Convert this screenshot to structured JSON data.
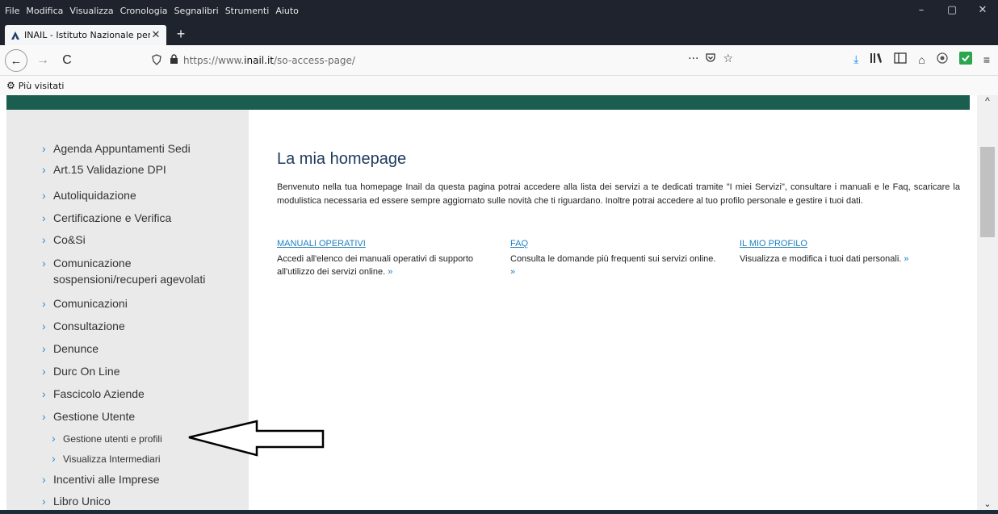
{
  "menubar": {
    "items": [
      "File",
      "Modifica",
      "Visualizza",
      "Cronologia",
      "Segnalibri",
      "Strumenti",
      "Aiuto"
    ]
  },
  "window_controls": {
    "minimize": "–",
    "maximize": "▢",
    "close": "✕"
  },
  "tab": {
    "title": "INAIL - Istituto Nazionale per l'A",
    "close": "✕",
    "new_tab": "+"
  },
  "navbar": {
    "back": "←",
    "forward": "→",
    "reload": "C",
    "url_prefix": "https://www.",
    "url_host": "inail.it",
    "url_path": "/so-access-page/",
    "page_actions": "···"
  },
  "bookmarks": {
    "label": "Più visitati"
  },
  "sidebar": {
    "items": [
      {
        "label": "Agenda Appuntamenti Sedi"
      },
      {
        "label": "Art.15 Validazione DPI"
      },
      {
        "label": "Autoliquidazione"
      },
      {
        "label": "Certificazione e Verifica"
      },
      {
        "label": "Co&Si"
      },
      {
        "label": "Comunicazione",
        "label2": "sospensioni/recuperi agevolati"
      },
      {
        "label": "Comunicazioni"
      },
      {
        "label": "Consultazione"
      },
      {
        "label": "Denunce"
      },
      {
        "label": "Durc On Line"
      },
      {
        "label": "Fascicolo Aziende"
      },
      {
        "label": "Gestione Utente"
      },
      {
        "label": "Gestione utenti e profili"
      },
      {
        "label": "Visualizza Intermediari"
      },
      {
        "label": "Incentivi alle Imprese"
      },
      {
        "label": "Libro Unico"
      }
    ]
  },
  "main": {
    "title": "La mia homepage",
    "intro": "Benvenuto nella tua homepage Inail da questa pagina potrai accedere alla lista dei servizi a te dedicati tramite \"I miei Servizi\", consultare i manuali e le Faq, scaricare la modulistica necessaria ed essere sempre aggiornato sulle novità che ti riguardano. Inoltre potrai accedere al tuo profilo personale e gestire i tuoi dati.",
    "columns": [
      {
        "heading": "MANUALI OPERATIVI",
        "text": "Accedi all'elenco dei manuali operativi di supporto all'utilizzo dei servizi online.",
        "more": "»"
      },
      {
        "heading": "FAQ",
        "text": "Consulta le domande più frequenti sui servizi online.",
        "more": "»"
      },
      {
        "heading": "IL MIO PROFILO",
        "text": "Visualizza e modifica i tuoi dati personali.",
        "more": "»"
      }
    ]
  },
  "colors": {
    "chrome_dark": "#1f232d",
    "green_band": "#1b5e50",
    "link": "#1f7fc0",
    "sidebar_bg": "#eaeaea",
    "chevron": "#2a8fd1"
  }
}
